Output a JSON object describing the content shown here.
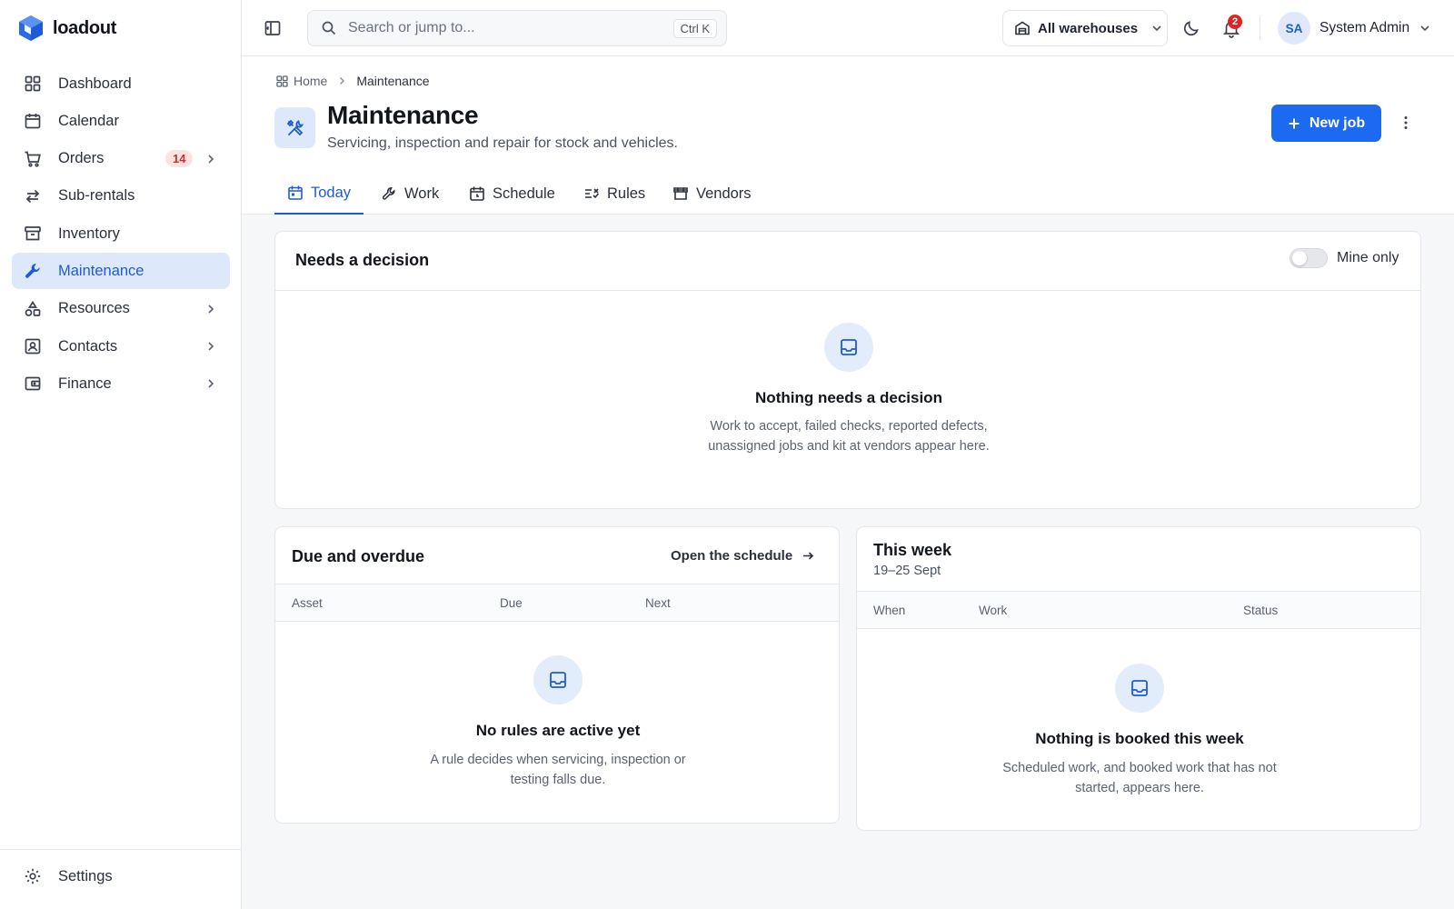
{
  "app": {
    "brand": "loadout"
  },
  "sidebar": {
    "items": [
      {
        "label": "Dashboard",
        "icon": "grid-icon"
      },
      {
        "label": "Calendar",
        "icon": "calendar-icon"
      },
      {
        "label": "Orders",
        "icon": "cart-icon",
        "badge": "14",
        "chevron": true
      },
      {
        "label": "Sub-rentals",
        "icon": "swap-icon"
      },
      {
        "label": "Inventory",
        "icon": "archive-icon"
      },
      {
        "label": "Maintenance",
        "icon": "wrench-icon",
        "active": true
      },
      {
        "label": "Resources",
        "icon": "shapes-icon",
        "chevron": true
      },
      {
        "label": "Contacts",
        "icon": "contact-card-icon",
        "chevron": true
      },
      {
        "label": "Finance",
        "icon": "wallet-icon",
        "chevron": true
      }
    ],
    "footer": {
      "settings_label": "Settings"
    }
  },
  "header": {
    "search_placeholder": "Search or jump to...",
    "search_value": "",
    "search_shortcut": "Ctrl K",
    "warehouse_label": "All warehouses",
    "notifications_count": "2",
    "user_initials": "SA",
    "user_name": "System Admin"
  },
  "breadcrumb": {
    "home": "Home",
    "current": "Maintenance"
  },
  "page": {
    "title": "Maintenance",
    "subtitle": "Servicing, inspection and repair for stock and vehicles.",
    "primary_action": "New job"
  },
  "tabs": [
    {
      "label": "Today",
      "active": true
    },
    {
      "label": "Work"
    },
    {
      "label": "Schedule"
    },
    {
      "label": "Rules"
    },
    {
      "label": "Vendors"
    }
  ],
  "needs_decision": {
    "title": "Needs a decision",
    "toggle_label": "Mine only",
    "toggle_on": false,
    "empty_title": "Nothing needs a decision",
    "empty_text": "Work to accept, failed checks, reported defects, unassigned jobs and kit at vendors appear here."
  },
  "due_overdue": {
    "title": "Due and overdue",
    "link_label": "Open the schedule",
    "columns": [
      "Asset",
      "Due",
      "Next"
    ],
    "empty_title": "No rules are active yet",
    "empty_text": "A rule decides when servicing, inspection or testing falls due."
  },
  "this_week": {
    "title": "This week",
    "date_range": "19–25 Sept",
    "columns": [
      "When",
      "Work",
      "Status"
    ],
    "empty_title": "Nothing is booked this week",
    "empty_text": "Scheduled work, and booked work that has not started, appears here."
  },
  "colors": {
    "accent": "#1d6af2",
    "accent_soft": "#dde9fb",
    "badge_red": "#e02424"
  }
}
